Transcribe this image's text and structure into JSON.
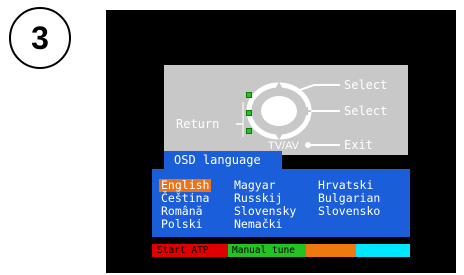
{
  "step_number": "3",
  "remote": {
    "select_top": "Select",
    "select_middle": "Select",
    "exit": "Exit",
    "return": "Return",
    "tv_av": "TV/AV"
  },
  "osd_title": "OSD language",
  "languages": {
    "col1": [
      "English",
      "Čeština",
      "Română",
      "Polski"
    ],
    "col2": [
      "Magyar",
      "Russkij",
      "Slovensky",
      "Nemački"
    ],
    "col3": [
      "Hrvatski",
      "Bulgarian",
      "Slovensko"
    ]
  },
  "selected_language": "English",
  "function_bar": {
    "red_label": "Start ATP",
    "green_label": "Manual tune",
    "red_color": "#e00000",
    "green_color": "#22c322",
    "orange_color": "#f07810",
    "cyan_color": "#00e8ff"
  }
}
